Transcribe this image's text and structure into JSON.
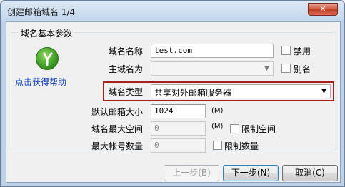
{
  "window": {
    "title": "创建邮箱域名 1/4",
    "close_glyph": "✕"
  },
  "group": {
    "legend": "域名基本参数"
  },
  "help": {
    "icon": "help-icon",
    "link_label": "点击获得帮助"
  },
  "form": {
    "domain_name_label": "域名名称",
    "domain_name_value": "test.com",
    "disable_label": "禁用",
    "primary_domain_label": "主域名为",
    "primary_domain_value": "",
    "alias_label": "别名",
    "domain_type_label": "域名类型",
    "domain_type_value": "共享对外邮箱服务器",
    "default_mailbox_size_label": "默认邮箱大小",
    "default_mailbox_size_value": "1024",
    "default_mailbox_size_unit": "(M)",
    "max_space_label": "域名最大空间",
    "max_space_value": "0",
    "max_space_unit": "(M)",
    "limit_space_label": "限制空间",
    "max_accounts_label": "最大帐号数量",
    "max_accounts_value": "0",
    "limit_count_label": "限制数量"
  },
  "buttons": {
    "prev_label": "上一步(B)",
    "next_label": "下一步(N)",
    "cancel_label": "取消(C)"
  }
}
